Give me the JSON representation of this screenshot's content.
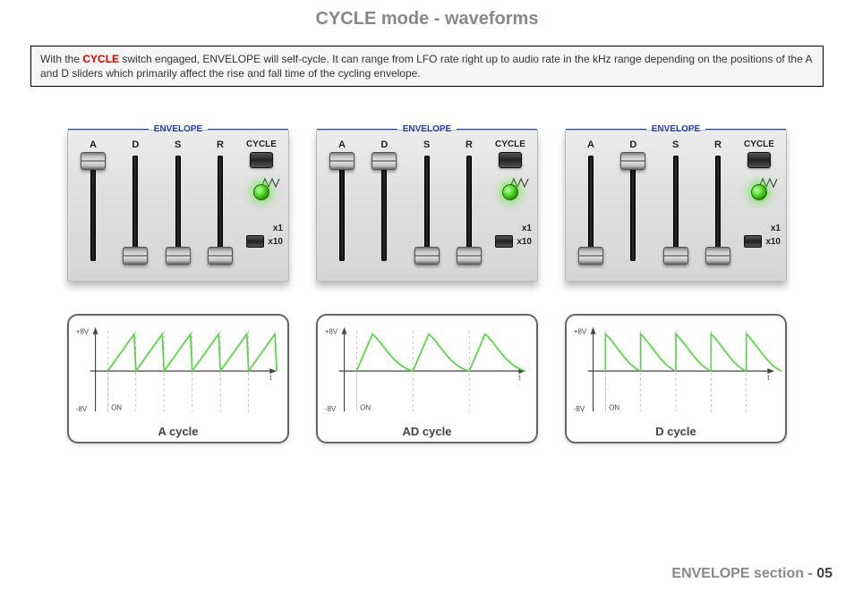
{
  "page_title": "CYCLE mode - waveforms",
  "description": {
    "prefix": "With the ",
    "keyword": "CYCLE",
    "rest": " switch engaged, ENVELOPE will self-cycle. It can range from LFO rate right up to audio rate in the kHz range depending on the positions of the A and D sliders which primarily affect the rise and fall time of the cycling envelope."
  },
  "envelope": {
    "title": "ENVELOPE",
    "labels": {
      "a": "A",
      "d": "D",
      "s": "S",
      "r": "R",
      "cycle": "CYCLE",
      "x1": "x1",
      "x10": "x10"
    }
  },
  "panels": [
    {
      "name": "A cycle",
      "sliders": {
        "A": 0.95,
        "D": 0.05,
        "S": 0.05,
        "R": 0.05
      }
    },
    {
      "name": "AD cycle",
      "sliders": {
        "A": 0.95,
        "D": 0.95,
        "S": 0.05,
        "R": 0.05
      }
    },
    {
      "name": "D cycle",
      "sliders": {
        "A": 0.05,
        "D": 0.95,
        "S": 0.05,
        "R": 0.05
      }
    }
  ],
  "plot": {
    "y_top": "+8V",
    "y_bot": "-8V",
    "x_label": "t",
    "trigger_label": "ON"
  },
  "footer": {
    "section": "ENVELOPE section - ",
    "page": "05"
  }
}
